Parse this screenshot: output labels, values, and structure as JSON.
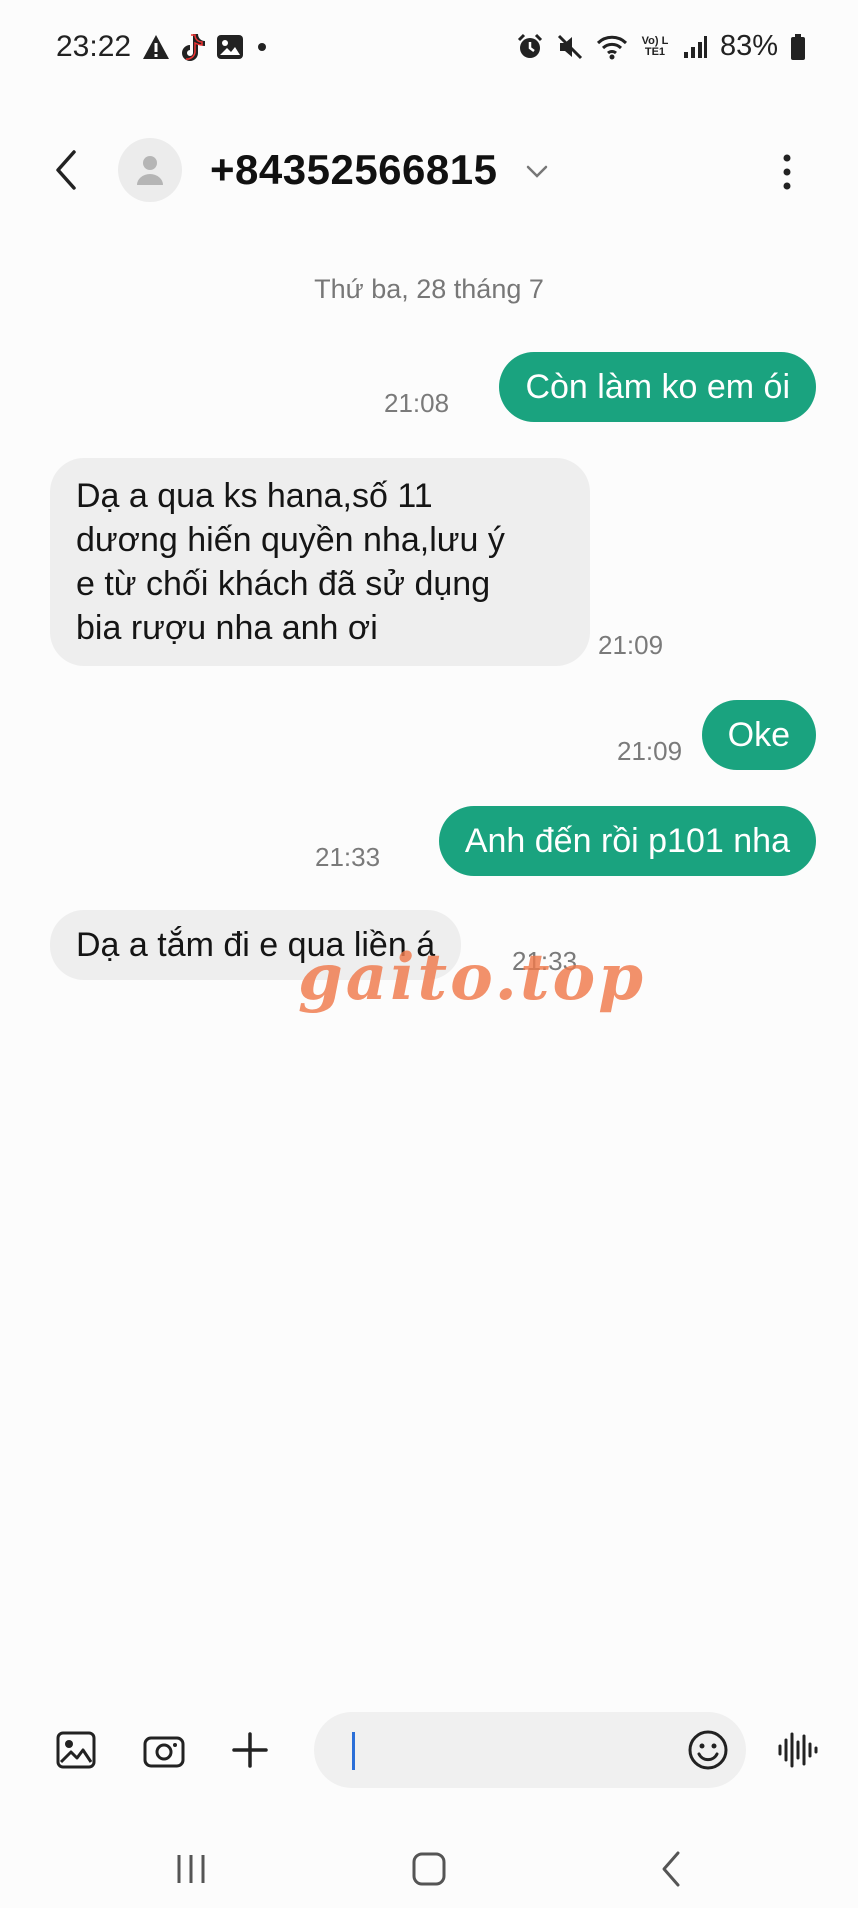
{
  "status_bar": {
    "time": "23:22",
    "left_icons": [
      "warning-icon",
      "tiktok-icon",
      "gallery-icon",
      "dot-icon"
    ],
    "right_icons": [
      "alarm-icon",
      "mute-icon",
      "wifi-icon",
      "volte-lte-icon",
      "signal-icon",
      "battery-icon"
    ],
    "volte_label": "Vo) LTE1",
    "battery": "83%"
  },
  "header": {
    "contact": "+84352566815",
    "icons": {
      "back": "back-arrow-icon",
      "avatar": "person-icon",
      "expand": "chevron-down-icon",
      "more": "more-vert-icon"
    }
  },
  "conversation": {
    "date_divider": "Thứ ba, 28 tháng 7",
    "messages": [
      {
        "direction": "outgoing",
        "text": "Còn làm ko em ói",
        "time": "21:08"
      },
      {
        "direction": "incoming",
        "lines": [
          "Dạ a qua ks hana,số 11",
          "dương hiến quyền nha,lưu ý",
          "e từ chối khách đã sử dụng",
          "bia rượu nha anh ơi"
        ],
        "time": "21:09"
      },
      {
        "direction": "outgoing",
        "text": "Oke",
        "time": "21:09"
      },
      {
        "direction": "outgoing",
        "text": "Anh đến rồi p101 nha",
        "time": "21:33"
      },
      {
        "direction": "incoming",
        "text": "Dạ a tắm đi e qua liền á",
        "time": "21:33"
      }
    ],
    "watermark": "gaito.top"
  },
  "composer": {
    "input_value": "",
    "icons": [
      "image-icon",
      "camera-icon",
      "plus-icon",
      "emoji-icon",
      "voice-icon"
    ]
  },
  "nav_bar": {
    "icons": [
      "recents-icon",
      "home-icon",
      "back-nav-icon"
    ]
  },
  "colors": {
    "outgoing_bubble": "#1aa37f",
    "incoming_bubble": "#eeeeee",
    "background": "#fcfcfc",
    "watermark": "#f07a4c"
  }
}
